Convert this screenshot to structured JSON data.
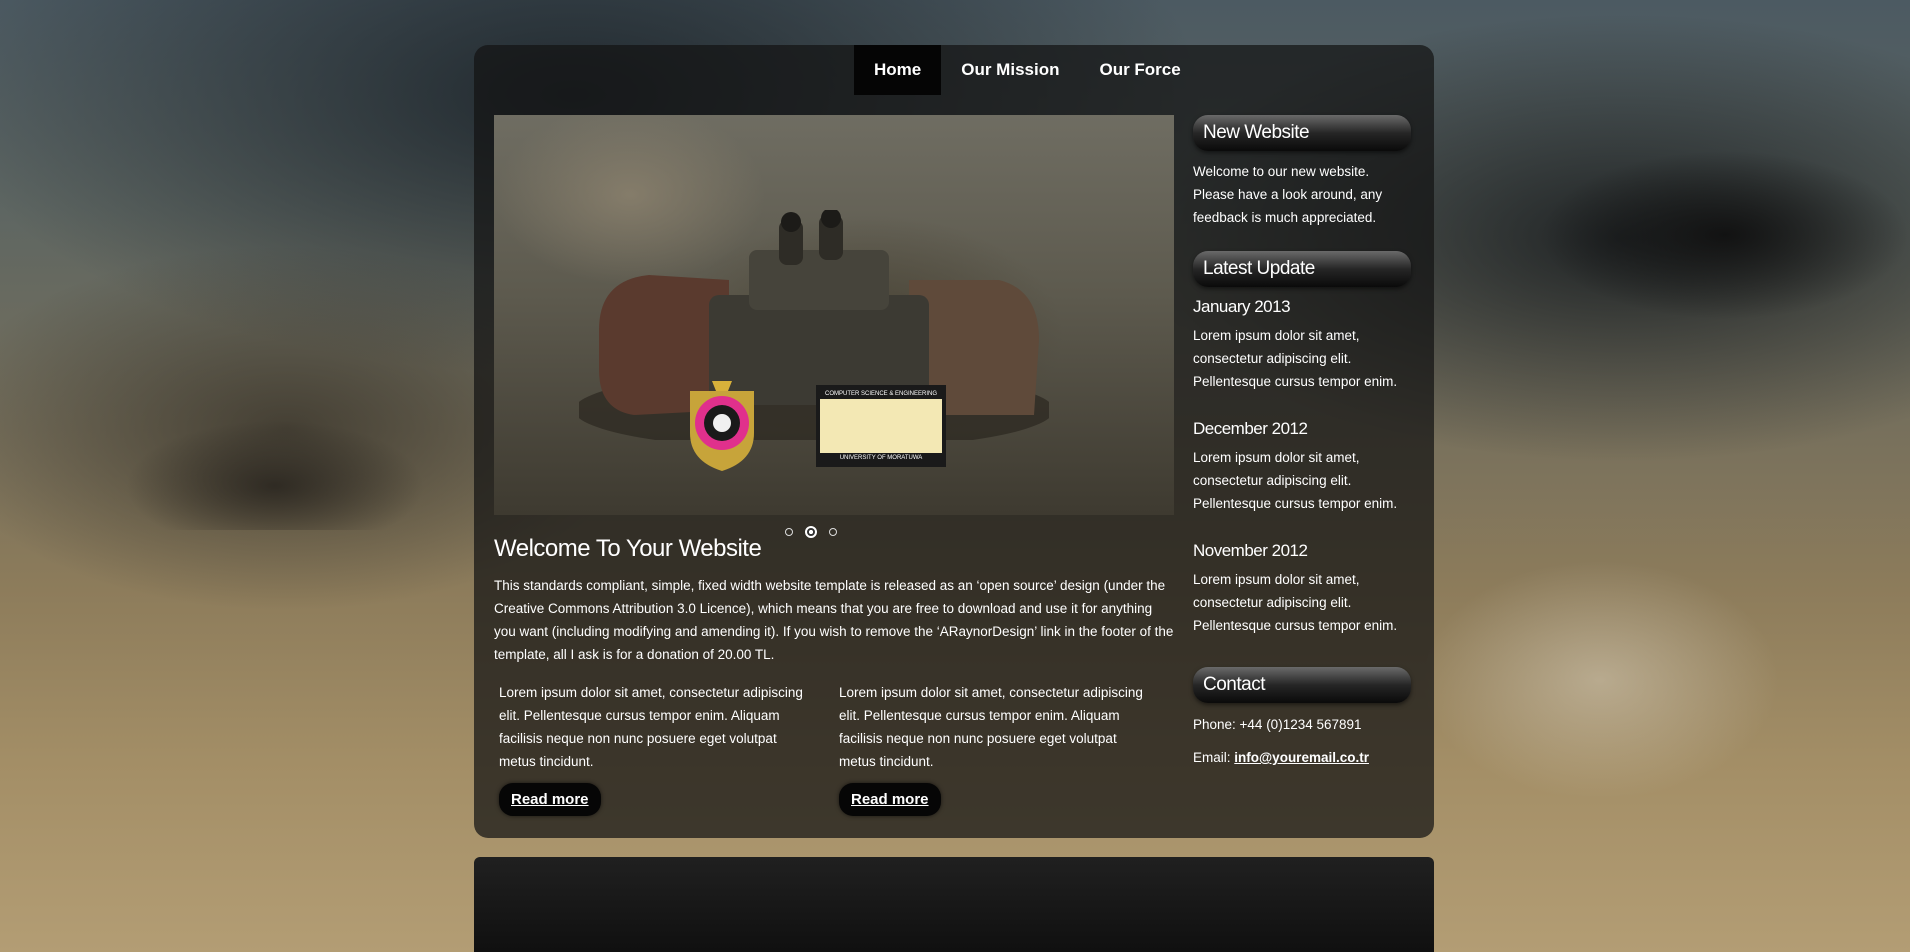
{
  "nav": {
    "items": [
      {
        "label": "Home",
        "active": true
      },
      {
        "label": "Our Mission",
        "active": false
      },
      {
        "label": "Our Force",
        "active": false
      }
    ]
  },
  "slider": {
    "image": "tank-battle-image",
    "logo_emblem": "university-of-moratuwa-crest",
    "logo_cse_top": "COMPUTER SCIENCE & ENGINEERING",
    "logo_cse_bottom": "UNIVERSITY OF MORATUWA",
    "dots": 3,
    "active_dot": 2
  },
  "main": {
    "title": "Welcome To Your Website",
    "intro": "This standards compliant, simple, fixed width website template is released as an ‘open source’ design (under the Creative Commons Attribution 3.0 Licence), which means that you are free to download and use it for anything you want (including modifying and amending it). If you wish to remove the ‘ARaynorDesign’ link in the footer of the template, all I ask is for a donation of 20.00 TL.",
    "columns": [
      {
        "text": "Lorem ipsum dolor sit amet, consectetur adipiscing elit. Pellentesque cursus tempor enim. Aliquam facilisis neque non nunc posuere eget volutpat metus tincidunt.",
        "button": "Read more"
      },
      {
        "text": "Lorem ipsum dolor sit amet, consectetur adipiscing elit. Pellentesque cursus tempor enim. Aliquam facilisis neque non nunc posuere eget volutpat metus tincidunt.",
        "button": "Read more"
      }
    ]
  },
  "sidebar": {
    "new_website": {
      "heading": "New Website",
      "text": "Welcome to our new website. Please have a look around, any feedback is much appreciated."
    },
    "latest_update": {
      "heading": "Latest Update",
      "items": [
        {
          "date": "January 2013",
          "text": "Lorem ipsum dolor sit amet, consectetur adipiscing elit. Pellentesque cursus tempor enim."
        },
        {
          "date": "December 2012",
          "text": "Lorem ipsum dolor sit amet, consectetur adipiscing elit. Pellentesque cursus tempor enim."
        },
        {
          "date": "November 2012",
          "text": "Lorem ipsum dolor sit amet, consectetur adipiscing elit. Pellentesque cursus tempor enim."
        }
      ]
    },
    "contact": {
      "heading": "Contact",
      "phone": "Phone: +44 (0)1234 567891",
      "email_label": "Email:",
      "email": "info@youremail.co.tr"
    }
  }
}
